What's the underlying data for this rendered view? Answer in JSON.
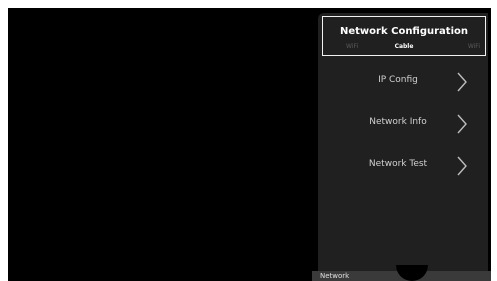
{
  "panel": {
    "title": "Network Configuration",
    "tabs": {
      "left": "WiFi",
      "center": "Cable",
      "right": "WiFi"
    },
    "items": [
      {
        "label": "IP Config",
        "icon": "chevron-right-icon"
      },
      {
        "label": "Network Info",
        "icon": "chevron-right-icon"
      },
      {
        "label": "Network Test",
        "icon": "chevron-right-icon"
      }
    ]
  },
  "footer": {
    "label": "Network"
  },
  "colors": {
    "background": "#000000",
    "panel": "#202020",
    "text": "#d0d0d0",
    "highlight": "#ffffff"
  }
}
